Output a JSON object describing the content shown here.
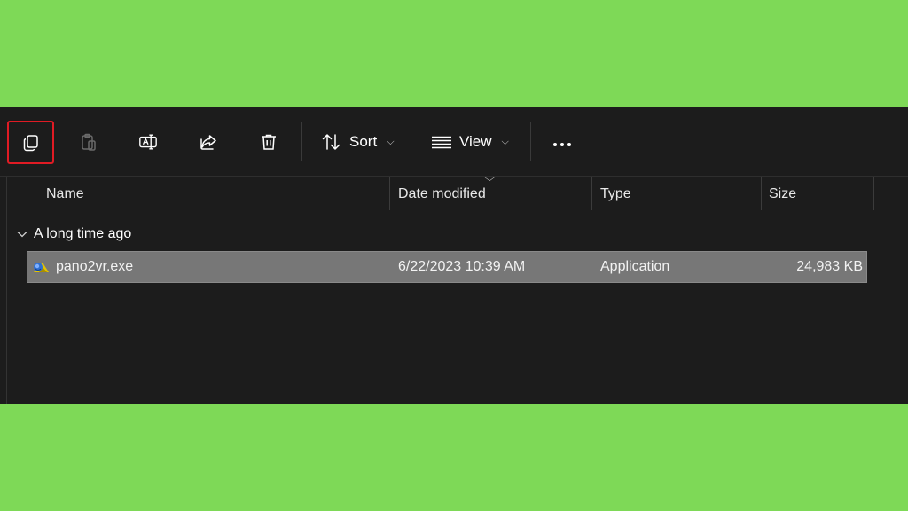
{
  "toolbar": {
    "copy_icon": "copy-icon",
    "paste_icon": "paste-icon",
    "rename_icon": "rename-icon",
    "share_icon": "share-icon",
    "delete_icon": "trash-icon",
    "sort_label": "Sort",
    "view_label": "View",
    "more_icon": "more-horizontal-icon",
    "highlight_color": "#e01b24"
  },
  "columns": {
    "name": "Name",
    "date_modified": "Date modified",
    "type": "Type",
    "size": "Size"
  },
  "group": {
    "label": "A long time ago"
  },
  "files": [
    {
      "name": "pano2vr.exe",
      "date_modified": "6/22/2023 10:39 AM",
      "type": "Application",
      "size": "24,983 KB",
      "selected": true
    }
  ],
  "colors": {
    "background": "#7ed957",
    "window": "#1c1c1c",
    "selection": "#777777"
  }
}
